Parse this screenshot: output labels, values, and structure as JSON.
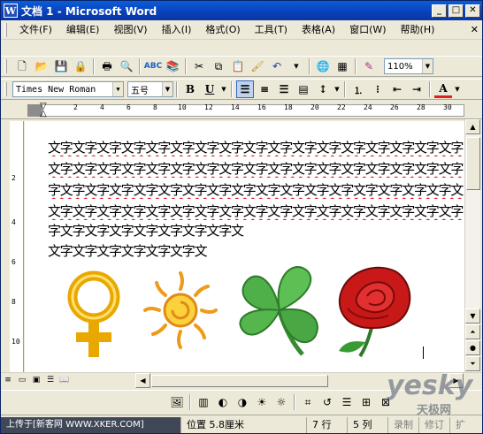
{
  "window": {
    "title": "文档 1 - Microsoft Word",
    "app_icon": "W"
  },
  "menu": [
    "文件(F)",
    "编辑(E)",
    "视图(V)",
    "插入(I)",
    "格式(O)",
    "工具(T)",
    "表格(A)",
    "窗口(W)",
    "帮助(H)"
  ],
  "toolbar": {
    "zoom": "110%"
  },
  "format": {
    "font": "Times New Roman",
    "size": "五号",
    "bold": "B",
    "underline": "U",
    "color_letter": "A"
  },
  "hruler": {
    "ticks": [
      "2",
      "4",
      "6",
      "8",
      "10",
      "12",
      "14",
      "16",
      "18",
      "20",
      "22",
      "24",
      "26",
      "28",
      "30"
    ]
  },
  "vruler": {
    "ticks": [
      "2",
      "4",
      "6",
      "8",
      "10"
    ]
  },
  "document": {
    "lines": [
      "文字文字文字文字文字文字文字文字文字文字文字文字文字文字文字文字文字文字文字文字",
      "文字文字文字文字文字文字文字文字文字文字文字文字文字文字文字文字文字文字文字文字",
      "字文字文字文字文字文字文字文字文字文字文字文字文字文字文字文字文字文字文字文字文",
      "文字文字文字文字文字文字文字文字文字文字文字文字文字文字文字文字文字文字文字文字",
      "字文字文字文字文字文字文字文字文",
      "文字文字文字文字文字文字文"
    ]
  },
  "status": {
    "position": "位置 5.8厘米",
    "row": "7 行",
    "col": "5 列",
    "rec": "录制",
    "trk": "修订",
    "ext": "扩"
  },
  "watermarks": {
    "left_bottom": "上传于[新客网 WWW.XKER.COM]",
    "right": "yesky",
    "right_cn": "天极网"
  },
  "colors": {
    "title_bar": "#0a3fb8",
    "squiggle": "#e02020",
    "rose": "#c81818",
    "clover": "#3ea040",
    "sun": "#f0a020",
    "venus": "#f0b000"
  }
}
